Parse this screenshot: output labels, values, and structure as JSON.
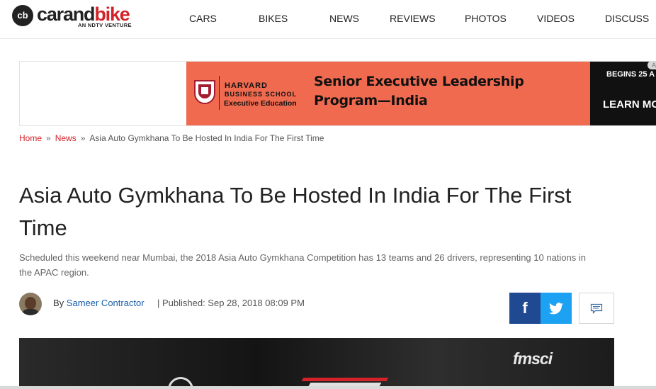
{
  "header": {
    "logo": {
      "word1": "carand",
      "word2": "bike",
      "tagline": "AN NDTV VENTURE",
      "mark": "cb"
    },
    "nav": [
      {
        "label": "CARS"
      },
      {
        "label": "BIKES"
      },
      {
        "label": "NEWS"
      },
      {
        "label": "REVIEWS"
      },
      {
        "label": "PHOTOS"
      },
      {
        "label": "VIDEOS"
      },
      {
        "label": "DISCUSS"
      }
    ]
  },
  "ad": {
    "brand_line1": "HARVARD",
    "brand_line2": "BUSINESS SCHOOL",
    "brand_line3": "Executive Education",
    "headline_line1": "Senior Executive Leadership",
    "headline_line2": "Program—India",
    "side_line1": "BEGINS 25 A",
    "side_cta": "LEARN MO",
    "close_glyph": "A",
    "banner_color": "#ef6a4f"
  },
  "breadcrumb": {
    "home": "Home",
    "section": "News",
    "current": "Asia Auto Gymkhana To Be Hosted In India For The First Time",
    "separator": "»"
  },
  "article": {
    "title": "Asia Auto Gymkhana To Be Hosted In India For The First Time",
    "summary": "Scheduled this weekend near Mumbai, the 2018 Asia Auto Gymkhana Competition has 13 teams and 26 drivers, representing 10 nations in the APAC region.",
    "by_prefix": "By",
    "author": "Sameer Contractor",
    "published": "| Published: Sep 28, 2018 08:09 PM"
  },
  "share": {
    "facebook_glyph": "f",
    "facebook_color": "#1f4a92",
    "twitter_color": "#1da1f2",
    "icons": [
      "facebook-icon",
      "twitter-icon",
      "comment-icon"
    ]
  },
  "hero": {
    "logo_text": "fmsci"
  },
  "colors": {
    "brand_red": "#d2232a",
    "link_blue": "#1b5fa8"
  }
}
